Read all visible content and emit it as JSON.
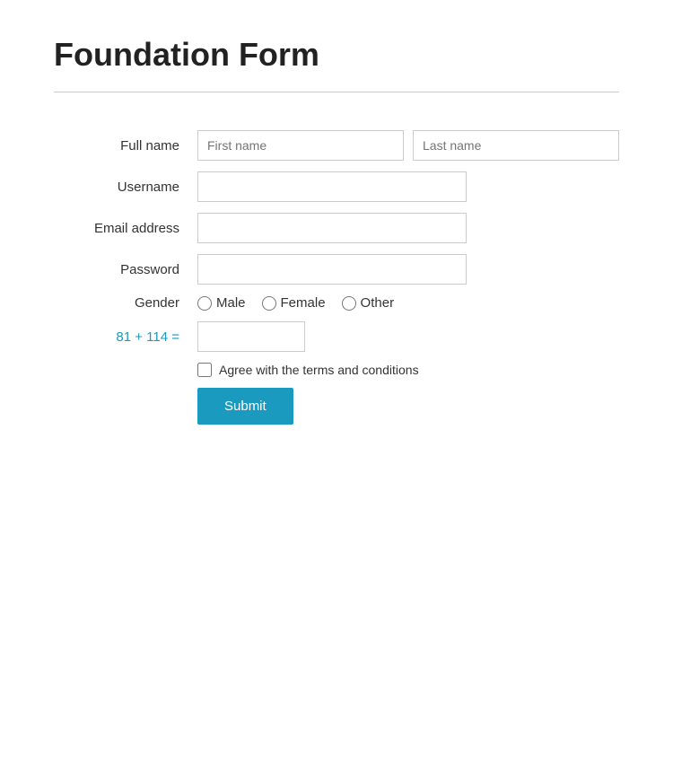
{
  "page": {
    "title": "Foundation Form"
  },
  "form": {
    "full_name_label": "Full name",
    "first_name_placeholder": "First name",
    "last_name_placeholder": "Last name",
    "username_label": "Username",
    "email_label": "Email address",
    "password_label": "Password",
    "gender_label": "Gender",
    "gender_options": [
      {
        "value": "male",
        "label": "Male"
      },
      {
        "value": "female",
        "label": "Female"
      },
      {
        "value": "other",
        "label": "Other"
      }
    ],
    "captcha_label": "81 + 114 =",
    "terms_label": "Agree with the terms and conditions",
    "submit_label": "Submit"
  },
  "colors": {
    "accent": "#1a9abf",
    "divider": "#cccccc"
  }
}
